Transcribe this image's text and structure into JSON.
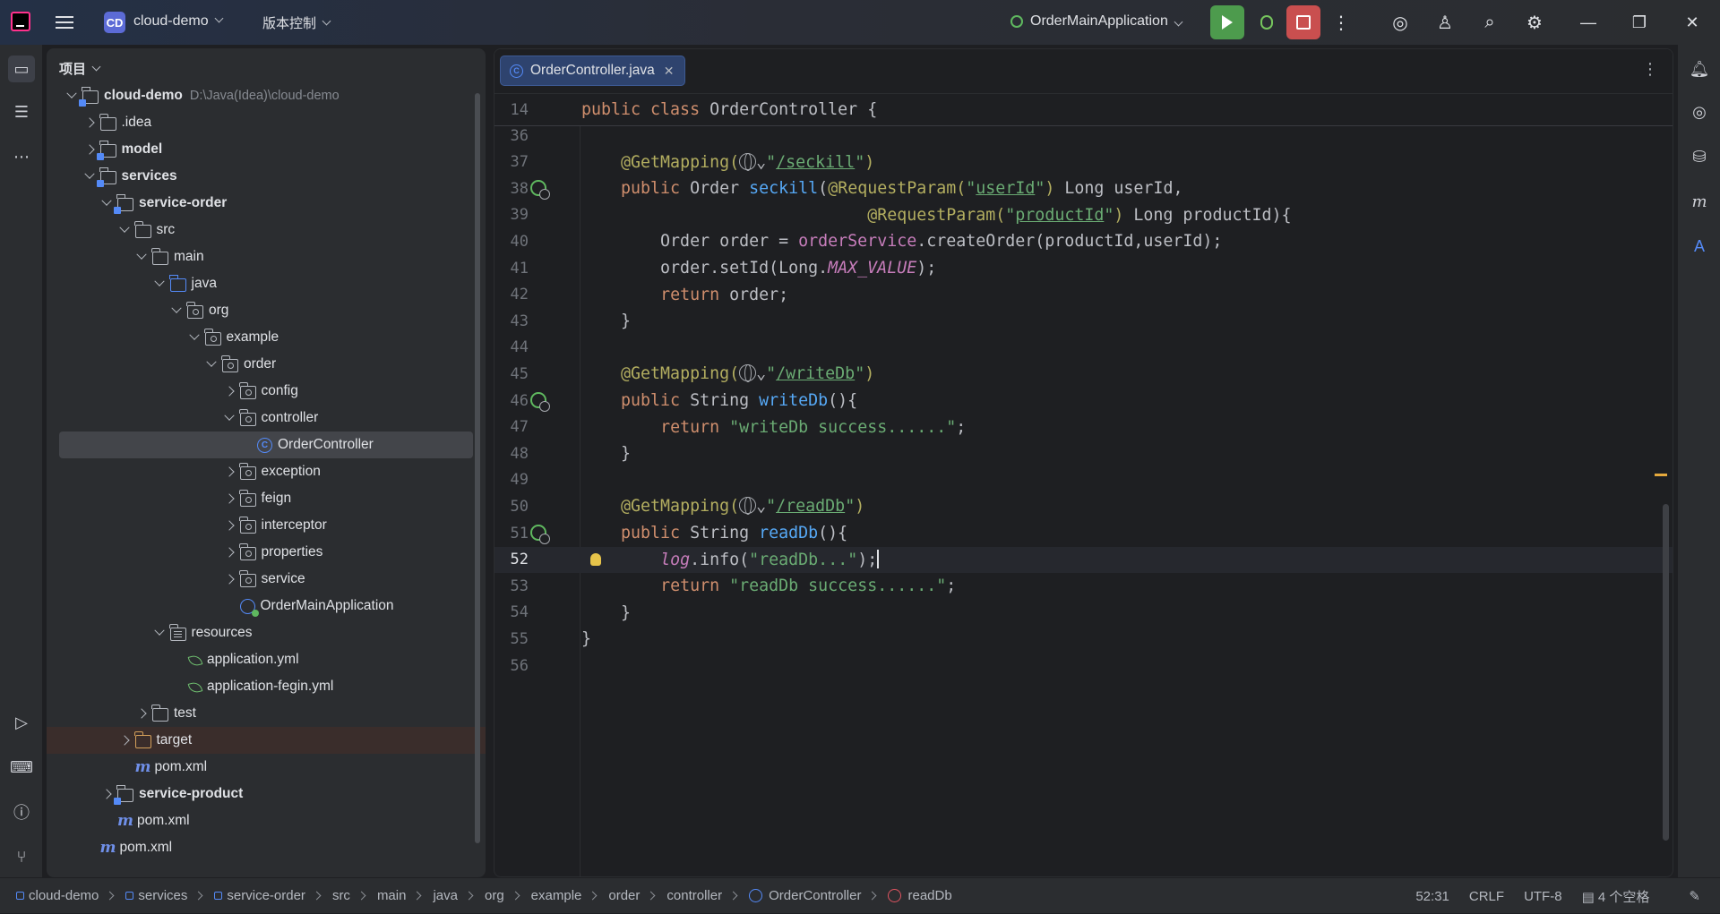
{
  "titlebar": {
    "project_badge": "CD",
    "project_name": "cloud-demo",
    "vcs_menu": "版本控制",
    "run_config": "OrderMainApplication"
  },
  "project_panel": {
    "header": "项目",
    "tree": [
      {
        "depth": 0,
        "arrow": "down",
        "icon": "module",
        "name": "cloud-demo",
        "bold": true,
        "path": "D:\\Java(Idea)\\cloud-demo"
      },
      {
        "depth": 1,
        "arrow": "right",
        "icon": "folder",
        "name": ".idea"
      },
      {
        "depth": 1,
        "arrow": "right",
        "icon": "module",
        "name": "model",
        "bold": true
      },
      {
        "depth": 1,
        "arrow": "down",
        "icon": "module",
        "name": "services",
        "bold": true
      },
      {
        "depth": 2,
        "arrow": "down",
        "icon": "module",
        "name": "service-order",
        "bold": true
      },
      {
        "depth": 3,
        "arrow": "down",
        "icon": "folder",
        "name": "src"
      },
      {
        "depth": 4,
        "arrow": "down",
        "icon": "folder",
        "name": "main"
      },
      {
        "depth": 5,
        "arrow": "down",
        "icon": "src",
        "name": "java"
      },
      {
        "depth": 6,
        "arrow": "down",
        "icon": "pkg",
        "name": "org"
      },
      {
        "depth": 7,
        "arrow": "down",
        "icon": "pkg",
        "name": "example"
      },
      {
        "depth": 8,
        "arrow": "down",
        "icon": "pkg",
        "name": "order"
      },
      {
        "depth": 9,
        "arrow": "right",
        "icon": "pkg",
        "name": "config"
      },
      {
        "depth": 9,
        "arrow": "down",
        "icon": "pkg",
        "name": "controller"
      },
      {
        "depth": 10,
        "arrow": "none",
        "icon": "class",
        "name": "OrderController",
        "selected": true
      },
      {
        "depth": 9,
        "arrow": "right",
        "icon": "pkg",
        "name": "exception"
      },
      {
        "depth": 9,
        "arrow": "right",
        "icon": "pkg",
        "name": "feign"
      },
      {
        "depth": 9,
        "arrow": "right",
        "icon": "pkg",
        "name": "interceptor"
      },
      {
        "depth": 9,
        "arrow": "right",
        "icon": "pkg",
        "name": "properties"
      },
      {
        "depth": 9,
        "arrow": "right",
        "icon": "pkg",
        "name": "service"
      },
      {
        "depth": 9,
        "arrow": "none",
        "icon": "boot",
        "name": "OrderMainApplication"
      },
      {
        "depth": 5,
        "arrow": "down",
        "icon": "res",
        "name": "resources"
      },
      {
        "depth": 6,
        "arrow": "none",
        "icon": "yml",
        "name": "application.yml"
      },
      {
        "depth": 6,
        "arrow": "none",
        "icon": "yml",
        "name": "application-fegin.yml"
      },
      {
        "depth": 4,
        "arrow": "right",
        "icon": "folder",
        "name": "test"
      },
      {
        "depth": 3,
        "arrow": "right",
        "icon": "target",
        "name": "target",
        "excluded": true
      },
      {
        "depth": 3,
        "arrow": "none",
        "icon": "maven",
        "name": "pom.xml"
      },
      {
        "depth": 2,
        "arrow": "right",
        "icon": "module",
        "name": "service-product",
        "bold": true
      },
      {
        "depth": 2,
        "arrow": "none",
        "icon": "maven",
        "name": "pom.xml"
      },
      {
        "depth": 1,
        "arrow": "none",
        "icon": "maven",
        "name": "pom.xml"
      }
    ]
  },
  "editor": {
    "tab_label": "OrderController.java",
    "inspections": {
      "warnings": "1",
      "weak_warnings": "2"
    },
    "sticky_line": {
      "num": "14",
      "segments": [
        [
          "kw",
          "public class "
        ],
        [
          "",
          "OrderController {"
        ]
      ]
    },
    "lines": [
      {
        "num": "36",
        "segments": []
      },
      {
        "num": "37",
        "segments": [
          [
            "",
            "    "
          ],
          [
            "an",
            "@GetMapping("
          ],
          [
            "globe",
            ""
          ],
          [
            "",
            "⌄"
          ],
          [
            "st",
            "\""
          ],
          [
            "st u",
            "/seckill"
          ],
          [
            "st",
            "\""
          ],
          [
            "an",
            ")"
          ]
        ]
      },
      {
        "num": "38",
        "gicon": true,
        "segments": [
          [
            "",
            "    "
          ],
          [
            "kw",
            "public "
          ],
          [
            "",
            "Order "
          ],
          [
            "fn",
            "seckill"
          ],
          [
            "",
            "("
          ],
          [
            "an",
            "@RequestParam("
          ],
          [
            "st",
            "\""
          ],
          [
            "st u",
            "userId"
          ],
          [
            "st",
            "\""
          ],
          [
            "an",
            ")"
          ],
          [
            "",
            " Long userId,"
          ]
        ]
      },
      {
        "num": "39",
        "segments": [
          [
            "",
            "                             "
          ],
          [
            "an",
            "@RequestParam("
          ],
          [
            "st",
            "\""
          ],
          [
            "st u",
            "productId"
          ],
          [
            "st",
            "\""
          ],
          [
            "an",
            ")"
          ],
          [
            "",
            " Long productId){"
          ]
        ]
      },
      {
        "num": "40",
        "segments": [
          [
            "",
            "        Order order = "
          ],
          [
            "fld",
            "orderService"
          ],
          [
            "",
            ".createOrder(productId,userId);"
          ]
        ]
      },
      {
        "num": "41",
        "segments": [
          [
            "",
            "        order.setId(Long."
          ],
          [
            "ital",
            "MAX_VALUE"
          ],
          [
            "",
            ");"
          ]
        ]
      },
      {
        "num": "42",
        "segments": [
          [
            "",
            "        "
          ],
          [
            "kw",
            "return "
          ],
          [
            "",
            "order;"
          ]
        ]
      },
      {
        "num": "43",
        "segments": [
          [
            "",
            "    }"
          ]
        ]
      },
      {
        "num": "44",
        "segments": []
      },
      {
        "num": "45",
        "segments": [
          [
            "",
            "    "
          ],
          [
            "an",
            "@GetMapping("
          ],
          [
            "globe",
            ""
          ],
          [
            "",
            "⌄"
          ],
          [
            "st",
            "\""
          ],
          [
            "st u",
            "/writeDb"
          ],
          [
            "st",
            "\""
          ],
          [
            "an",
            ")"
          ]
        ]
      },
      {
        "num": "46",
        "gicon": true,
        "segments": [
          [
            "",
            "    "
          ],
          [
            "kw",
            "public "
          ],
          [
            "",
            "String "
          ],
          [
            "fn",
            "writeDb"
          ],
          [
            "",
            "(){"
          ]
        ]
      },
      {
        "num": "47",
        "segments": [
          [
            "",
            "        "
          ],
          [
            "kw",
            "return "
          ],
          [
            "st",
            "\"writeDb success......\""
          ],
          [
            "",
            ";"
          ]
        ]
      },
      {
        "num": "48",
        "segments": [
          [
            "",
            "    }"
          ]
        ]
      },
      {
        "num": "49",
        "segments": []
      },
      {
        "num": "50",
        "segments": [
          [
            "",
            "    "
          ],
          [
            "an",
            "@GetMapping("
          ],
          [
            "globe",
            ""
          ],
          [
            "",
            "⌄"
          ],
          [
            "st",
            "\""
          ],
          [
            "st u",
            "/readDb"
          ],
          [
            "st",
            "\""
          ],
          [
            "an",
            ")"
          ]
        ]
      },
      {
        "num": "51",
        "gicon": true,
        "segments": [
          [
            "",
            "    "
          ],
          [
            "kw",
            "public "
          ],
          [
            "",
            "String "
          ],
          [
            "fn",
            "readDb"
          ],
          [
            "",
            "(){"
          ]
        ]
      },
      {
        "num": "52",
        "current": true,
        "bulb": true,
        "segments": [
          [
            "",
            "        "
          ],
          [
            "ital",
            "log"
          ],
          [
            "",
            ".info("
          ],
          [
            "st",
            "\"readDb...\""
          ],
          [
            "",
            ");"
          ],
          [
            "cursor",
            ""
          ]
        ]
      },
      {
        "num": "53",
        "segments": [
          [
            "",
            "        "
          ],
          [
            "kw",
            "return "
          ],
          [
            "st",
            "\"readDb success......\""
          ],
          [
            "",
            ";"
          ]
        ]
      },
      {
        "num": "54",
        "segments": [
          [
            "",
            "    }"
          ]
        ]
      },
      {
        "num": "55",
        "segments": [
          [
            "",
            "}"
          ]
        ]
      },
      {
        "num": "56",
        "segments": []
      }
    ]
  },
  "statusbar": {
    "breadcrumbs": [
      {
        "icon": "sq",
        "label": "cloud-demo"
      },
      {
        "icon": "sq",
        "label": "services"
      },
      {
        "icon": "sq",
        "label": "service-order"
      },
      {
        "icon": "",
        "label": "src"
      },
      {
        "icon": "",
        "label": "main"
      },
      {
        "icon": "",
        "label": "java"
      },
      {
        "icon": "",
        "label": "org"
      },
      {
        "icon": "",
        "label": "example"
      },
      {
        "icon": "",
        "label": "order"
      },
      {
        "icon": "",
        "label": "controller"
      },
      {
        "icon": "cm",
        "label": "OrderController"
      },
      {
        "icon": "mm",
        "label": "readDb"
      }
    ],
    "position": "52:31",
    "line_sep": "CRLF",
    "encoding": "UTF-8",
    "indent": "4 个空格"
  }
}
